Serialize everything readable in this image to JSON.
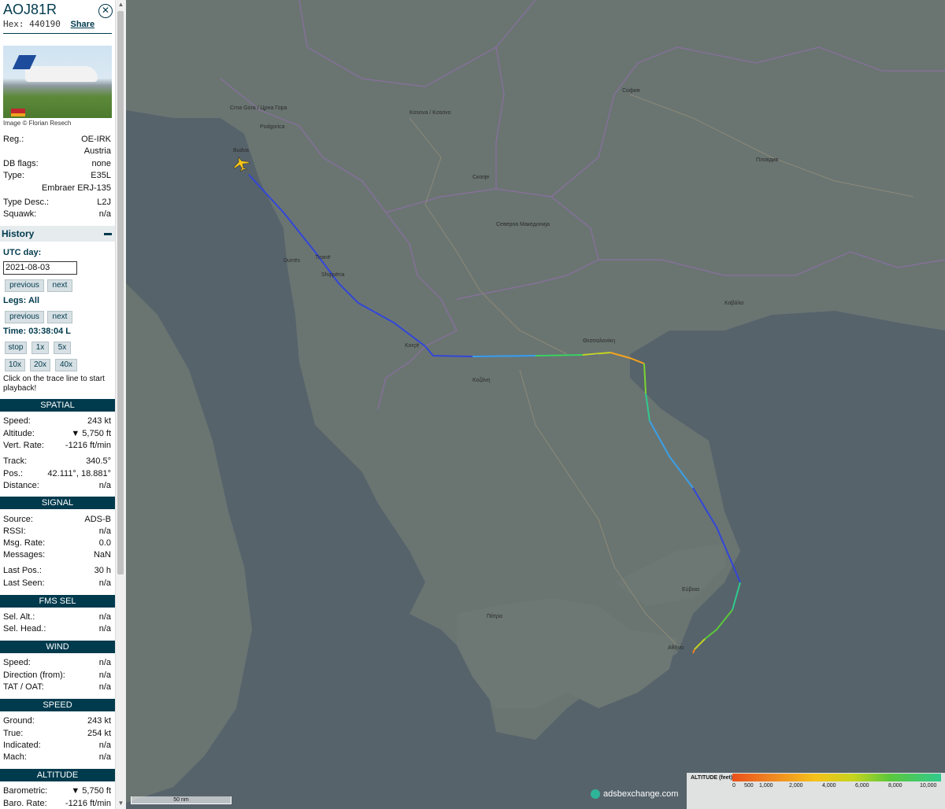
{
  "sidebar": {
    "callsign": "AOJ81R",
    "hex_label": "Hex:",
    "hex": "440190",
    "share_label": "Share",
    "photo_credit": "Image © Florian Resech",
    "info": [
      {
        "label": "Reg.:",
        "value": "OE-IRK"
      },
      {
        "label": "",
        "value": "Austria"
      },
      {
        "label": "DB flags:",
        "value": "none"
      },
      {
        "label": "Type:",
        "value": "E35L"
      },
      {
        "label": "",
        "value": "Embraer ERJ-135"
      },
      {
        "label": "Type Desc.:",
        "value": "L2J"
      },
      {
        "label": "Squawk:",
        "value": "n/a"
      }
    ],
    "history": {
      "title": "History",
      "utc_day_label": "UTC day:",
      "date": "2021-08-03",
      "previous": "previous",
      "next": "next",
      "legs_label": "Legs: All",
      "time_label": "Time: 03:38:04 L",
      "stop": "stop",
      "speeds": [
        "1x",
        "5x",
        "10x",
        "20x",
        "40x"
      ],
      "note": "Click on the trace line to start playback!"
    },
    "sections": {
      "spatial": "SPATIAL",
      "signal": "SIGNAL",
      "fms": "FMS SEL",
      "wind": "WIND",
      "speed": "SPEED",
      "altitude": "ALTITUDE"
    },
    "spatial": [
      {
        "label": "Speed:",
        "value": "243 kt"
      },
      {
        "label": "Altitude:",
        "value": "▼ 5,750 ft"
      },
      {
        "label": "Vert. Rate:",
        "value": "-1216 ft/min"
      },
      {
        "label": "Track:",
        "value": "340.5°"
      },
      {
        "label": "Pos.:",
        "value": "42.111°, 18.881°"
      },
      {
        "label": "Distance:",
        "value": "n/a"
      }
    ],
    "signal": [
      {
        "label": "Source:",
        "value": "ADS-B"
      },
      {
        "label": "RSSI:",
        "value": "n/a"
      },
      {
        "label": "Msg. Rate:",
        "value": "0.0"
      },
      {
        "label": "Messages:",
        "value": "NaN"
      },
      {
        "label": "Last Pos.:",
        "value": "30 h"
      },
      {
        "label": "Last Seen:",
        "value": "n/a"
      }
    ],
    "fms": [
      {
        "label": "Sel. Alt.:",
        "value": "n/a"
      },
      {
        "label": "Sel. Head.:",
        "value": "n/a"
      }
    ],
    "wind": [
      {
        "label": "Speed:",
        "value": "n/a"
      },
      {
        "label": "Direction (from):",
        "value": "n/a"
      },
      {
        "label": "TAT / OAT:",
        "value": "n/a"
      }
    ],
    "speed": [
      {
        "label": "Ground:",
        "value": "243 kt"
      },
      {
        "label": "True:",
        "value": "254 kt"
      },
      {
        "label": "Indicated:",
        "value": "n/a"
      },
      {
        "label": "Mach:",
        "value": "n/a"
      }
    ],
    "altitude": [
      {
        "label": "Barometric:",
        "value": "▼ 5,750 ft"
      },
      {
        "label": "Baro. Rate:",
        "value": "-1216 ft/min"
      }
    ]
  },
  "map": {
    "scale_label": "50 nm",
    "brand": "adsbexchange.com",
    "legend_title": "ALTITUDE (feet)",
    "legend_ticks": [
      "0",
      "500",
      "1,000",
      "2,000",
      "4,000",
      "6,000",
      "8,000",
      "10,000"
    ],
    "places": [
      "Crna Gora / Црна Гора",
      "Podgorica",
      "Kosova / Kosovo",
      "София",
      "Пловдив",
      "Скопје",
      "Tiranë",
      "Shqipëria",
      "Северна Македонија",
      "Θεσσαλονίκη",
      "Κοζάνη",
      "Αθήνα",
      "Πάτρα",
      "Εύβοια",
      "Budva",
      "Durrës",
      "Korçë",
      "Καβάλα"
    ],
    "colors": {
      "land": "#6a7572",
      "sea": "#55626a",
      "track_blue": "#3246d8",
      "track_green": "#3ed35a",
      "track_orange": "#f08421"
    }
  }
}
